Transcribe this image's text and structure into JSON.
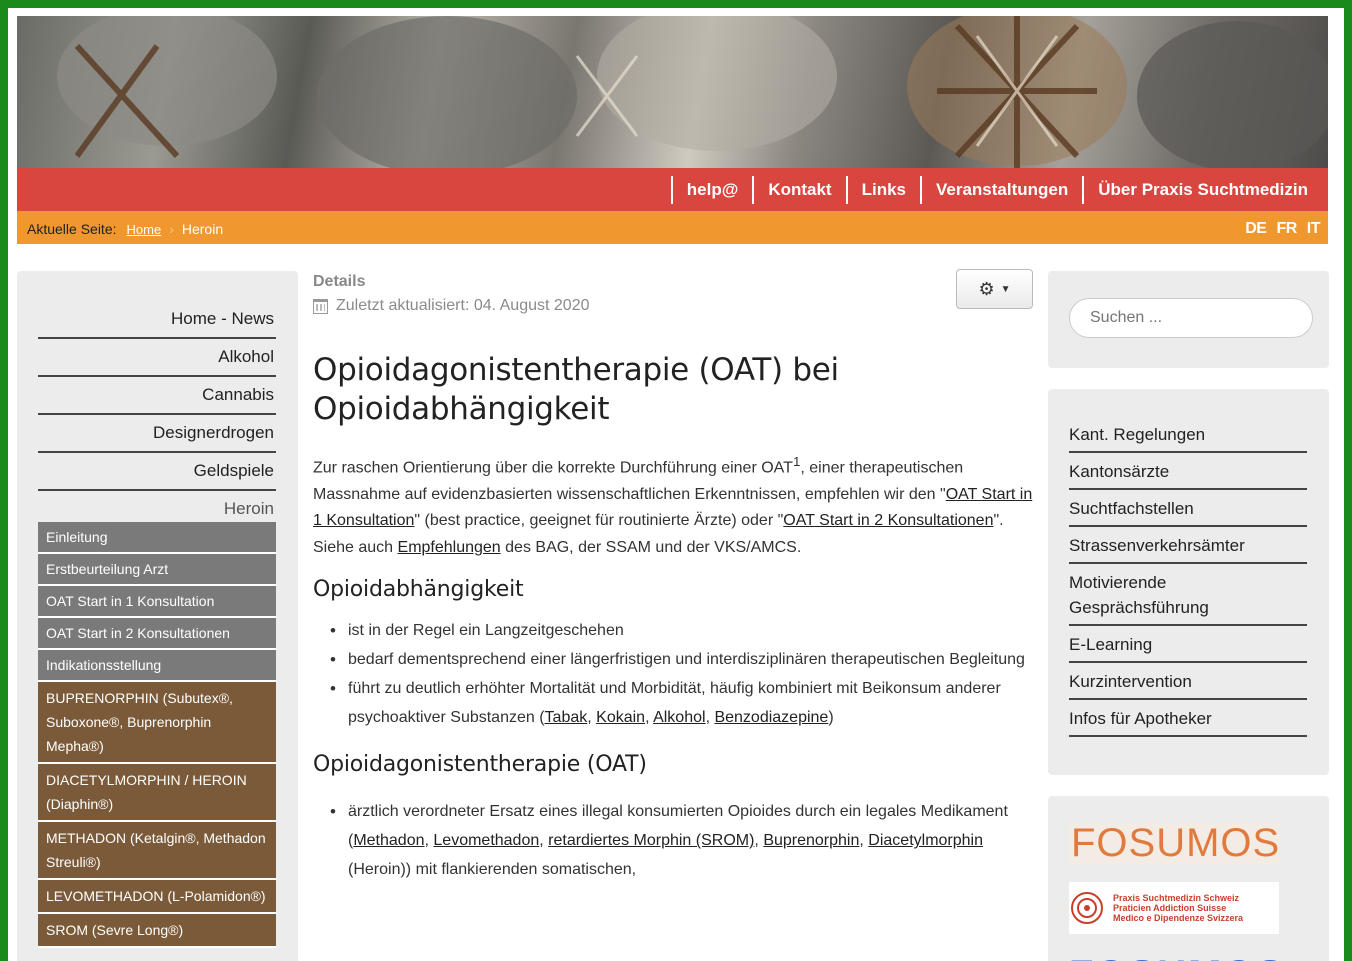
{
  "topnav": {
    "items": [
      "help@",
      "Kontakt",
      "Links",
      "Veranstaltungen",
      "Über Praxis Suchtmedizin"
    ]
  },
  "breadcrumb": {
    "label": "Aktuelle Seite:",
    "home": "Home",
    "current": "Heroin"
  },
  "languages": [
    "DE",
    "FR",
    "IT"
  ],
  "left_nav": {
    "items": [
      "Home - News",
      "Alkohol",
      "Cannabis",
      "Designerdrogen",
      "Geldspiele",
      "Heroin"
    ],
    "sub_items": [
      "Einleitung",
      "Erstbeurteilung Arzt",
      "OAT Start in 1 Konsultation",
      "OAT Start in 2 Konsultationen",
      "Indikationsstellung"
    ],
    "drug_items": [
      "BUPRENORPHIN (Subutex®, Suboxone®, Buprenorphin Mepha®)",
      "DIACETYLMORPHIN / HEROIN (Diaphin®)",
      "METHADON (Ketalgin®, Methadon Streuli®)",
      "LEVOMETHADON (L-Polamidon®)",
      "SROM (Sevre Long®)"
    ]
  },
  "article": {
    "details_label": "Details",
    "updated": "Zuletzt aktualisiert: 04. August 2020",
    "title": "Opioidagonistentherapie (OAT) bei Opioidabhängigkeit",
    "intro_1": "Zur raschen Orientierung über die korrekte Durchführung einer OAT",
    "intro_sup": "1",
    "intro_2": ", einer therapeutischen Massnahme auf evidenzbasierten wissenschaftlichen Erkenntnissen, empfehlen wir den \"",
    "link_oat1": "OAT Start in 1 Konsultation",
    "intro_3": "\" (best practice, geeignet für routinierte Ärzte) oder \"",
    "link_oat2": "OAT Start in 2 Konsultationen",
    "intro_4": "\". Siehe auch ",
    "link_empf": "Empfehlungen",
    "intro_5": " des BAG, der SSAM und der VKS/AMCS.",
    "h2_1": "Opioidabhängigkeit",
    "bullet_1": "ist in der Regel ein Langzeitgeschehen",
    "bullet_2": "bedarf dementsprechend einer längerfristigen und interdisziplinären therapeutischen Begleitung",
    "bullet_3_a": "führt zu deutlich erhöhter Mortalität und Morbidität, häufig kombiniert mit Beikonsum anderer psychoaktiver Substanzen (",
    "link_tabak": "Tabak",
    "link_kokain": "Kokain",
    "link_alkohol": "Alkohol",
    "link_benzo": "Benzodiazepine",
    "bullet_3_b": ")",
    "h2_2": "Opioidagonistentherapie (OAT)",
    "bullet_4_a": "ärztlich verordneter Ersatz eines illegal konsumierten Opioides durch ein legales Medikament (",
    "link_methadon": "Methadon",
    "link_levomethadon": "Levomethadon",
    "link_srom": "retardiertes Morphin (SROM)",
    "link_bupre": "Buprenorphin",
    "link_diacetyl": "Diacetylmorphin",
    "bullet_4_b": " (Heroin)) mit flankierenden somatischen,",
    "comma": ", "
  },
  "search": {
    "placeholder": "Suchen ..."
  },
  "right_nav": {
    "items": [
      "Kant. Regelungen",
      "Kantonsärzte",
      "Suchtfachstellen",
      "Strassenverkehrsämter",
      "Motivierende Gesprächsführung",
      "E-Learning",
      "Kurzintervention",
      "Infos für Apotheker"
    ]
  },
  "logos": {
    "fosumos": "FOSUMOS",
    "psm_line1": "Praxis Suchtmedizin Schweiz",
    "psm_line2": "Praticien Addiction Suisse",
    "psm_line3": "Medico e Dipendenze Svizzera",
    "partial": "FOSUMOS"
  }
}
